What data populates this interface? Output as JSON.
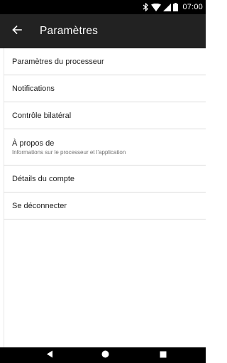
{
  "status_bar": {
    "time": "07:00",
    "icons": [
      "bluetooth-icon",
      "wifi-icon",
      "signal-icon",
      "battery-icon"
    ]
  },
  "toolbar": {
    "back_icon": "arrow-back-icon",
    "title": "Paramètres"
  },
  "settings": {
    "items": [
      {
        "label": "Paramètres du processeur"
      },
      {
        "label": "Notifications"
      },
      {
        "label": "Contrôle bilatéral"
      },
      {
        "label": "À propos de",
        "subtitle": "Informations sur le processeur et l'application"
      },
      {
        "label": "Détails du compte"
      },
      {
        "label": "Se déconnecter"
      }
    ]
  },
  "nav_bar": {
    "buttons": [
      "back-triangle-icon",
      "home-circle-icon",
      "recents-square-icon"
    ]
  },
  "colors": {
    "toolbar_bg": "#222222",
    "status_bg": "#000000",
    "divider": "#dcdcdc"
  }
}
